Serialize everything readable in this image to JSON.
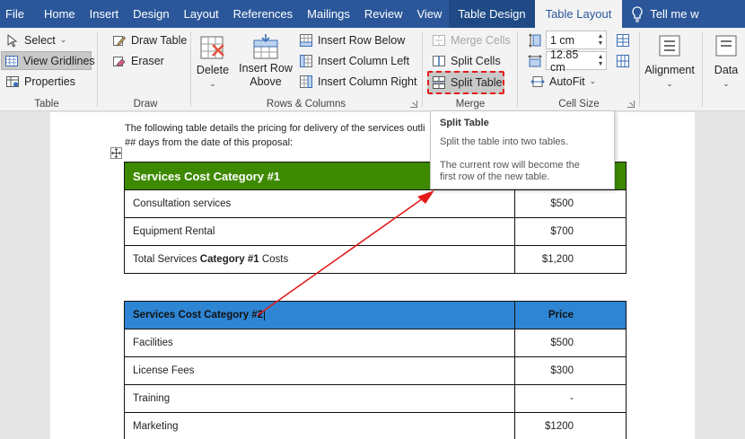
{
  "tabs": [
    {
      "label": "File"
    },
    {
      "label": "Home"
    },
    {
      "label": "Insert"
    },
    {
      "label": "Design"
    },
    {
      "label": "Layout"
    },
    {
      "label": "References"
    },
    {
      "label": "Mailings"
    },
    {
      "label": "Review"
    },
    {
      "label": "View"
    },
    {
      "label": "Table Design"
    },
    {
      "label": "Table Layout"
    },
    {
      "label": "Tell me w"
    }
  ],
  "ribbon": {
    "table": {
      "select": "Select",
      "view_gridlines": "View Gridlines",
      "properties": "Properties",
      "label": "Table"
    },
    "draw": {
      "draw_table": "Draw Table",
      "eraser": "Eraser",
      "label": "Draw"
    },
    "rows_columns": {
      "delete": "Delete",
      "insert_row_above_1": "Insert Row",
      "insert_row_above_2": "Above",
      "insert_row_below": "Insert Row Below",
      "insert_column_left": "Insert Column Left",
      "insert_column_right": "Insert Column Right",
      "label": "Rows & Columns"
    },
    "merge": {
      "merge_cells": "Merge Cells",
      "split_cells": "Split Cells",
      "split_table": "Split Table",
      "label": "Merge"
    },
    "cell_size": {
      "height": "1 cm",
      "width": "12.85 cm",
      "autofit": "AutoFit",
      "label": "Cell Size"
    },
    "alignment": {
      "label": "Alignment"
    },
    "data": {
      "label": "Data"
    }
  },
  "document": {
    "intro_line1": "The following table details the pricing for delivery of the services outli",
    "intro_line2": "## days from the date of this proposal:",
    "table1": {
      "header": "Services Cost Category #1",
      "rows": [
        {
          "label": "Consultation services",
          "price": "$500"
        },
        {
          "label": "Equipment Rental",
          "price": "$700"
        },
        {
          "label_pre": "Total Services ",
          "label_bold": "Category #1",
          "label_post": " Costs",
          "price": "$1,200"
        }
      ]
    },
    "table2": {
      "header": "Services Cost Category #2",
      "price_header": "Price",
      "rows": [
        {
          "label": "Facilities",
          "price": "$500"
        },
        {
          "label": "License Fees",
          "price": "$300"
        },
        {
          "label": "Training",
          "price": "-"
        },
        {
          "label": "Marketing",
          "price": "$1200"
        }
      ]
    }
  },
  "tooltip": {
    "title": "Split Table",
    "line1": "Split the table into two tables.",
    "line2": "The current row will become the",
    "line3": "first row of the new table."
  },
  "colors": {
    "ribbon_blue": "#2b579a",
    "table1_header": "#3d8a00",
    "table2_header": "#2e85d4",
    "highlight_red": "#e41b1b"
  }
}
